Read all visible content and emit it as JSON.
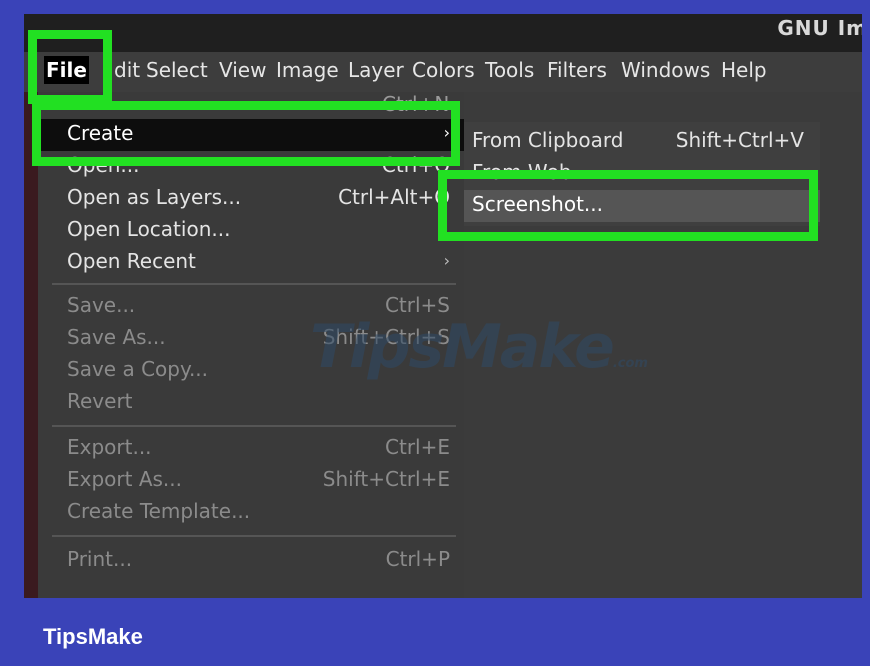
{
  "window": {
    "title": "GNU Im"
  },
  "menubar": {
    "items": [
      "File",
      "dit",
      "Select",
      "View",
      "Image",
      "Layer",
      "Colors",
      "Tools",
      "Filters",
      "Windows",
      "Help"
    ]
  },
  "file_menu": {
    "ghost_top": "Ctrl+N",
    "create": {
      "label": "Create",
      "arrow": "›"
    },
    "open": {
      "label": "Open...",
      "shortcut": "Ctrl+O"
    },
    "open_layers": {
      "label": "Open as Layers...",
      "shortcut": "Ctrl+Alt+O"
    },
    "open_location": {
      "label": "Open Location..."
    },
    "open_recent": {
      "label": "Open Recent",
      "arrow": "›"
    },
    "save": {
      "label": "Save...",
      "shortcut": "Ctrl+S"
    },
    "save_as": {
      "label": "Save As...",
      "shortcut": "Shift+Ctrl+S"
    },
    "save_copy": {
      "label": "Save a Copy..."
    },
    "revert": {
      "label": "Revert"
    },
    "export": {
      "label": "Export...",
      "shortcut": "Ctrl+E"
    },
    "export_as": {
      "label": "Export As...",
      "shortcut": "Shift+Ctrl+E"
    },
    "create_template": {
      "label": "Create Template..."
    },
    "print": {
      "label": "Print...",
      "shortcut": "Ctrl+P"
    }
  },
  "submenu": {
    "from_clipboard": {
      "label": "From Clipboard",
      "shortcut": "Shift+Ctrl+V"
    },
    "from_web": {
      "label": "From Web..."
    },
    "screenshot": {
      "label": "Screenshot..."
    }
  },
  "watermark": {
    "text": "TipsMake",
    "suffix": ".com"
  },
  "footer": {
    "brand": "TipsMake"
  },
  "colors": {
    "frame": "#3a43b8",
    "highlight": "#22e022",
    "menu_bg": "#3a3a3a"
  }
}
